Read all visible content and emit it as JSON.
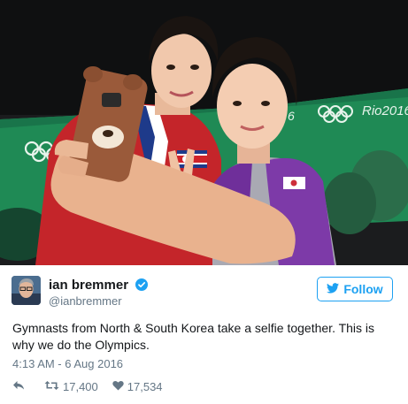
{
  "tweet": {
    "display_name": "ian bremmer",
    "handle": "@ianbremmer",
    "follow_label": "Follow",
    "text": "Gymnasts from North & South Korea take a selfie together. This is why we do the Olympics.",
    "timestamp": "4:13 AM - 6 Aug 2016",
    "retweets": "17,400",
    "likes": "17,534"
  },
  "photo": {
    "banner_text": "Rio2016",
    "rings_text": "6"
  },
  "icons": {
    "verified": "verified-badge-icon",
    "follow": "twitter-bird-icon",
    "reply": "reply-icon",
    "retweet": "retweet-icon",
    "like": "heart-icon"
  },
  "colors": {
    "accent": "#1da1f2",
    "text": "#14171a",
    "muted": "#657786"
  }
}
